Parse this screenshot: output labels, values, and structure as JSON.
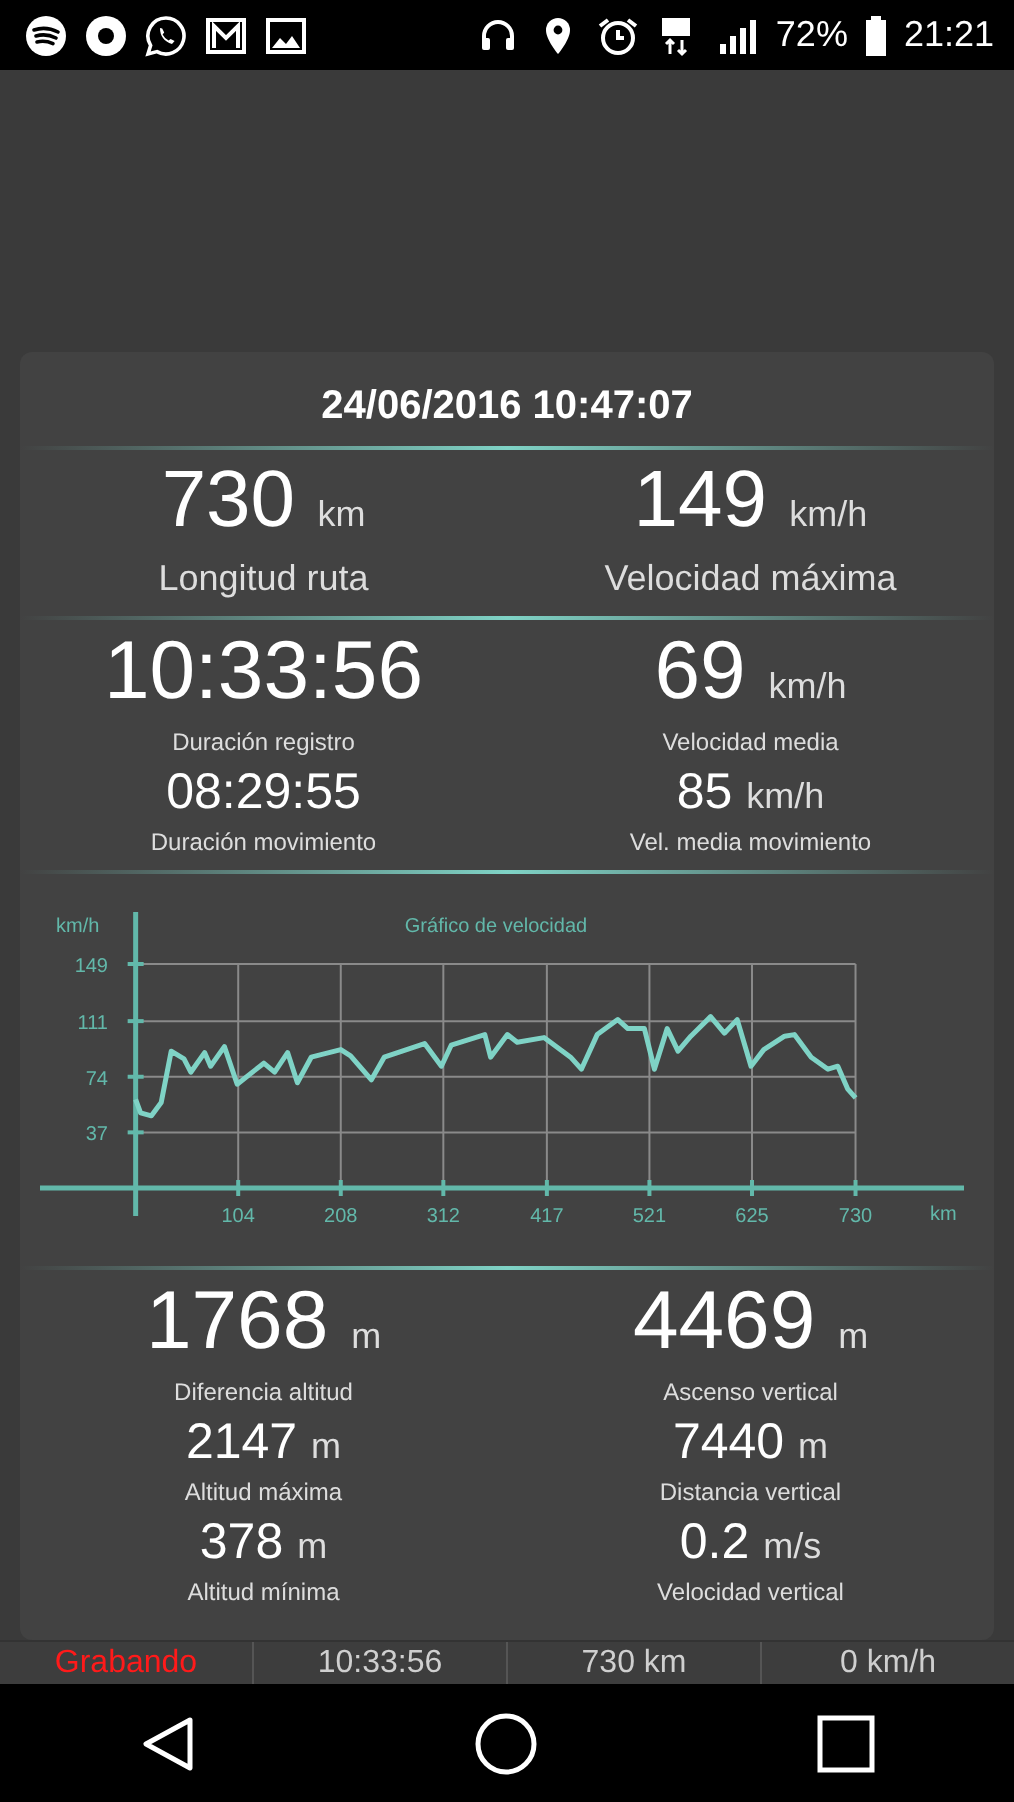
{
  "status_bar": {
    "battery_text": "72%",
    "time": "21:21"
  },
  "card": {
    "title": "24/06/2016 10:47:07",
    "sections": [
      {
        "rows": [
          {
            "kind": "hero",
            "cells": [
              {
                "value": "730",
                "unit": "km",
                "label": "Longitud ruta"
              },
              {
                "value": "149",
                "unit": "km/h",
                "label": "Velocidad máxima"
              }
            ]
          }
        ]
      },
      {
        "rows": [
          {
            "kind": "large",
            "cells": [
              {
                "value": "10:33:56",
                "label": "Duración registro"
              },
              {
                "value": "69",
                "unit": "km/h",
                "label": "Velocidad media"
              }
            ]
          },
          {
            "kind": "medium",
            "cells": [
              {
                "value": "08:29:55",
                "label": "Duración movimiento"
              },
              {
                "value": "85",
                "unit": "km/h",
                "label": "Vel. media movimiento"
              }
            ]
          }
        ]
      },
      {
        "chart_data": {
          "type": "line",
          "grid": true,
          "title": "Gráfico de velocidad",
          "xlabel": "km",
          "ylabel": "km/h",
          "xlim": [
            -97,
            840
          ],
          "ylim": [
            0,
            149
          ],
          "xticks": [
            104,
            208,
            312,
            417,
            521,
            625,
            730
          ],
          "yticks": [
            37,
            74,
            111,
            149
          ],
          "x": [
            0,
            5,
            16,
            26,
            36,
            49,
            56,
            70,
            76,
            90,
            103,
            130,
            141,
            154,
            164,
            178,
            208,
            218,
            239,
            252,
            293,
            310,
            320,
            354,
            360,
            377,
            387,
            414,
            441,
            452,
            468,
            489,
            499,
            516,
            526,
            539,
            550,
            563,
            583,
            597,
            610,
            624,
            637,
            658,
            668,
            685,
            702,
            712,
            722,
            730
          ],
          "series": [
            {
              "color": "#7fd3c6",
              "values": [
                59,
                50,
                48,
                57,
                91,
                86,
                77,
                90,
                81,
                94,
                69,
                83,
                77,
                90,
                70,
                87,
                92,
                88,
                72,
                87,
                96,
                81,
                95,
                102,
                87,
                102,
                97,
                100,
                87,
                79,
                102,
                112,
                106,
                106,
                79,
                106,
                91,
                101,
                114,
                103,
                112,
                81,
                92,
                101,
                102,
                87,
                79,
                81,
                66,
                60
              ]
            }
          ]
        }
      },
      {
        "rows": [
          {
            "kind": "large",
            "cells": [
              {
                "value": "1768",
                "unit": "m",
                "label": "Diferencia altitud"
              },
              {
                "value": "4469",
                "unit": "m",
                "label": "Ascenso vertical"
              }
            ]
          },
          {
            "kind": "medium",
            "cells": [
              {
                "value": "2147",
                "unit": "m",
                "label": "Altitud máxima"
              },
              {
                "value": "7440",
                "unit": "m",
                "label": "Distancia vertical"
              }
            ]
          },
          {
            "kind": "medium",
            "cells": [
              {
                "value": "378",
                "unit": "m",
                "label": "Altitud mínima"
              },
              {
                "value": "0.2",
                "unit": "m/s",
                "label": "Velocidad vertical"
              }
            ]
          }
        ]
      }
    ]
  },
  "bottom_bar": [
    {
      "text": "Grabando",
      "color": "#ff1a1a"
    },
    {
      "text": "10:33:56",
      "color": "#cfcfcf"
    },
    {
      "text": "730 km",
      "color": "#cfcfcf"
    },
    {
      "text": "0 km/h",
      "color": "#cfcfcf"
    }
  ]
}
